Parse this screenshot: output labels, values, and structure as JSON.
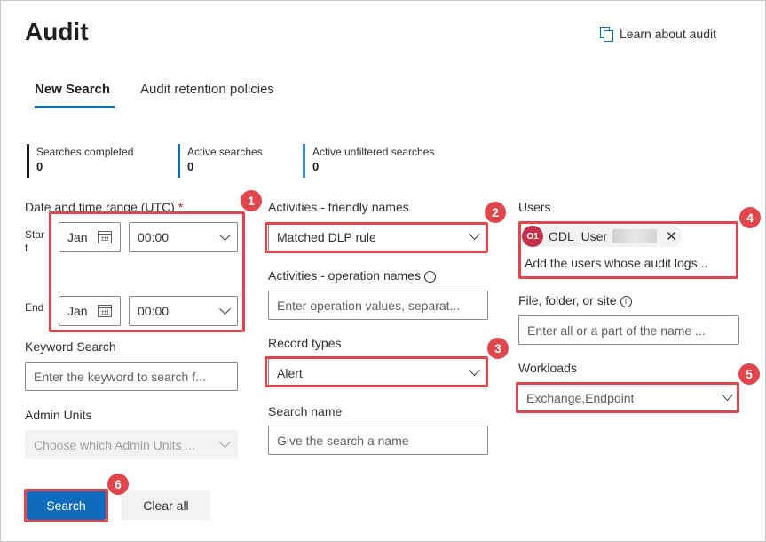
{
  "page": {
    "title": "Audit",
    "learn_link": "Learn about audit"
  },
  "tabs": [
    {
      "label": "New Search"
    },
    {
      "label": "Audit retention policies"
    }
  ],
  "stats": [
    {
      "label": "Searches completed",
      "value": "0"
    },
    {
      "label": "Active searches",
      "value": "0"
    },
    {
      "label": "Active unfiltered searches",
      "value": "0"
    }
  ],
  "date_range": {
    "label": "Date and time range (UTC)",
    "required_mark": "*",
    "start_label": "Start",
    "end_label": "End",
    "start_date": "Jan",
    "start_time": "00:00",
    "end_date": "Jan",
    "end_time": "00:00"
  },
  "keyword": {
    "label": "Keyword Search",
    "placeholder": "Enter the keyword to search f..."
  },
  "admin_units": {
    "label": "Admin Units",
    "placeholder": "Choose which Admin Units ..."
  },
  "activities_friendly": {
    "label": "Activities - friendly names",
    "value": "Matched DLP rule"
  },
  "activities_operation": {
    "label": "Activities - operation names",
    "placeholder": "Enter operation values, separat..."
  },
  "record_types": {
    "label": "Record types",
    "value": "Alert"
  },
  "search_name": {
    "label": "Search name",
    "placeholder": "Give the search a name"
  },
  "users": {
    "label": "Users",
    "chip_initials": "O1",
    "chip_name": "ODL_User",
    "placeholder": "Add the users whose audit logs..."
  },
  "file_folder": {
    "label": "File, folder, or site",
    "placeholder": "Enter all or a part of the name ..."
  },
  "workloads": {
    "label": "Workloads",
    "value": "Exchange,Endpoint"
  },
  "buttons": {
    "search": "Search",
    "clear": "Clear all"
  },
  "callouts": [
    "1",
    "2",
    "3",
    "4",
    "5",
    "6"
  ],
  "colors": {
    "accent": "#0f6cbd",
    "callout": "#e0474c",
    "avatar": "#c4314b"
  }
}
